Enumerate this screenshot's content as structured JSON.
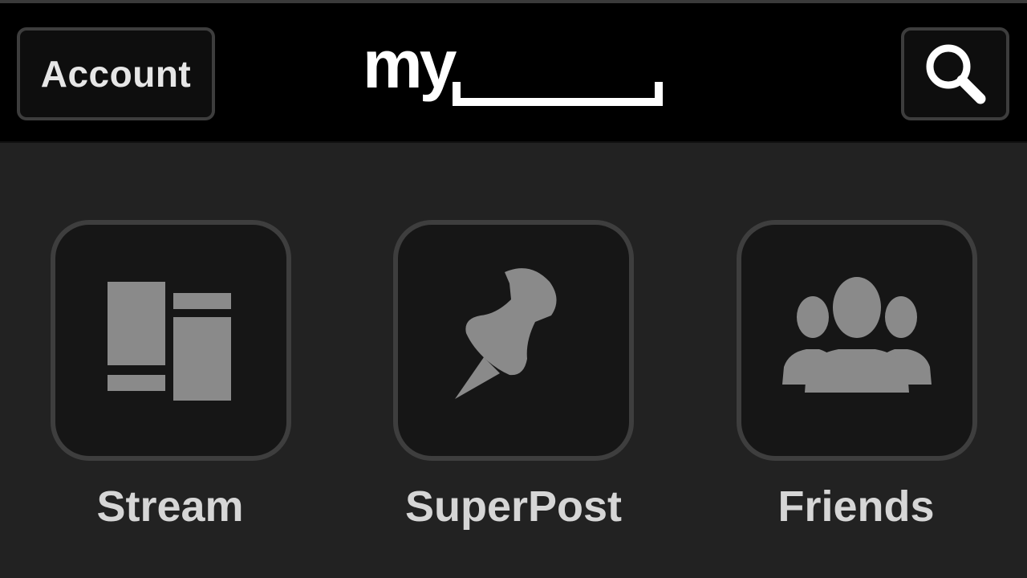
{
  "header": {
    "account_label": "Account",
    "logo_text": "my",
    "search_icon": "search-icon"
  },
  "tiles": [
    {
      "label": "Stream",
      "icon": "stream-icon"
    },
    {
      "label": "SuperPost",
      "icon": "pushpin-icon"
    },
    {
      "label": "Friends",
      "icon": "friends-icon"
    }
  ],
  "colors": {
    "header_bg": "#000000",
    "body_bg": "#222222",
    "tile_bg": "#161616",
    "tile_border": "#3e3e3e",
    "icon_fill": "#8a8a8a",
    "label_text": "#d6d6d6",
    "logo": "#ffffff"
  }
}
